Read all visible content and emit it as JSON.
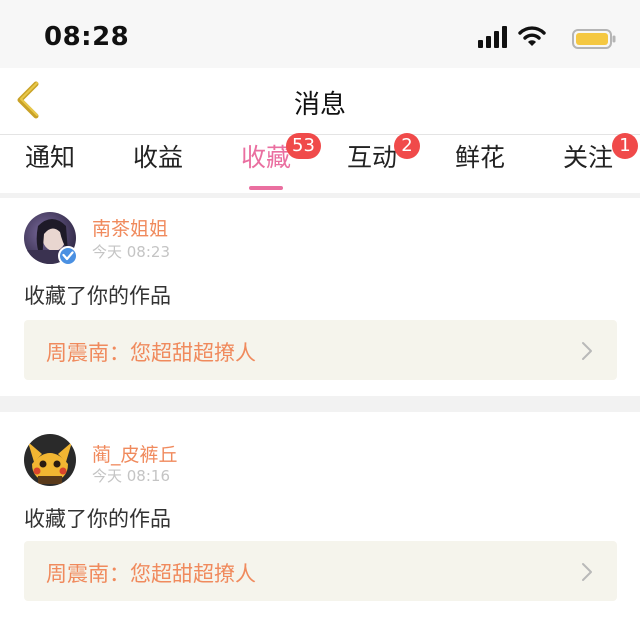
{
  "status_bar": {
    "time": "08:28",
    "icons": [
      "signal-icon",
      "wifi-icon",
      "battery-icon"
    ],
    "battery_color": "#f5c842"
  },
  "nav": {
    "back_icon": "chevron-left-icon",
    "title": "消息"
  },
  "tabs": [
    {
      "label": "通知",
      "badge": ""
    },
    {
      "label": "收益",
      "badge": ""
    },
    {
      "label": "收藏",
      "badge": "53",
      "active": true
    },
    {
      "label": "互动",
      "badge": "2"
    },
    {
      "label": "鲜花",
      "badge": ""
    },
    {
      "label": "关注",
      "badge": "1"
    }
  ],
  "colors": {
    "accent_pink": "#ea6fa0",
    "name_orange": "#f08a5d",
    "badge_red": "#f04a4a",
    "verified_blue": "#4a90e2"
  },
  "notifications": [
    {
      "user_name": "南茶姐姐",
      "time": "今天 08:23",
      "verified": true,
      "action": "收藏了你的作品",
      "work_title": "周震南：您超甜超撩人"
    },
    {
      "user_name": "蔺_皮裤丘",
      "time": "今天 08:16",
      "verified": false,
      "action": "收藏了你的作品",
      "work_title": "周震南：您超甜超撩人"
    }
  ]
}
